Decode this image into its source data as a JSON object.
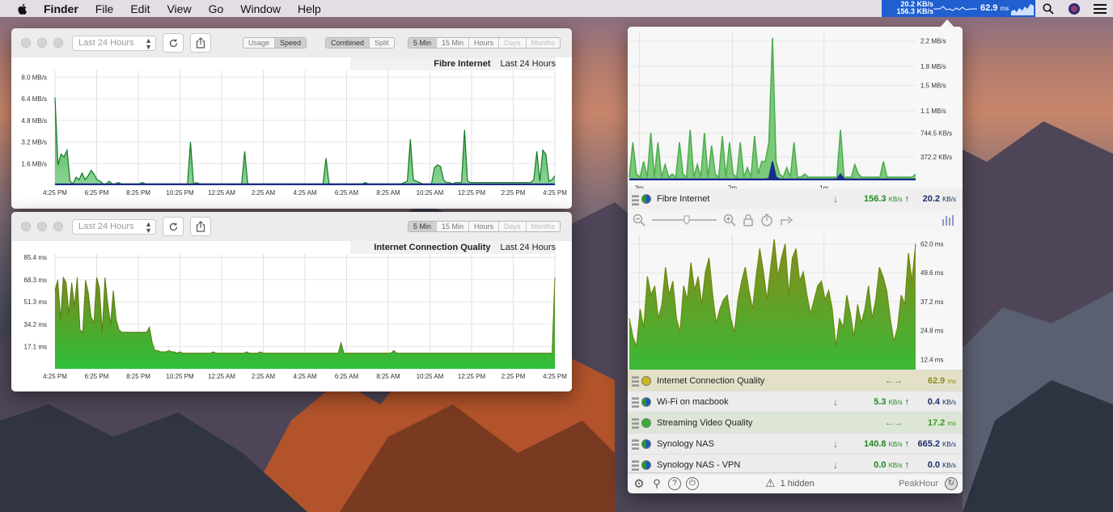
{
  "menubar": {
    "app_name": "Finder",
    "items": [
      "File",
      "Edit",
      "View",
      "Go",
      "Window",
      "Help"
    ],
    "peakhour_down": "20.2 KB/s",
    "peakhour_up": "156.3 KB/s",
    "peakhour_ms": "62.9",
    "peakhour_ms_unit": "ms"
  },
  "window1": {
    "range_popup": "Last 24 Hours",
    "mode_seg": [
      "Usage",
      "Speed"
    ],
    "view_seg": [
      "Combined",
      "Split"
    ],
    "interval_seg": [
      "5 Min",
      "15 Min",
      "Hours",
      "Days",
      "Months"
    ],
    "chart_title": "Fibre Internet",
    "chart_range": "Last 24 Hours"
  },
  "window2": {
    "range_popup": "Last 24 Hours",
    "interval_seg": [
      "5 Min",
      "15 Min",
      "Hours",
      "Days",
      "Months"
    ],
    "chart_title": "Internet Connection Quality",
    "chart_range": "Last 24 Hours"
  },
  "colors": {
    "green": "#2ea52e",
    "navy": "#1a2d8a",
    "olive": "#8b8b1e"
  },
  "chart_data": [
    {
      "type": "area",
      "title": "Fibre Internet",
      "x_ticks": [
        "4:25 PM",
        "6:25 PM",
        "8:25 PM",
        "10:25 PM",
        "12:25 AM",
        "2:25 AM",
        "4:25 AM",
        "6:25 AM",
        "8:25 AM",
        "10:25 AM",
        "12:25 PM",
        "2:25 PM",
        "4:25 PM"
      ],
      "y_ticks": [
        "8.0 MB/s",
        "6.4 MB/s",
        "4.8 MB/s",
        "3.2 MB/s",
        "1.6 MB/s"
      ],
      "ylim": [
        0,
        8.5
      ],
      "series": [
        {
          "values": [
            6.5,
            1.5,
            2.3,
            2.1,
            2.6,
            0.3,
            0.1,
            0.6,
            0.4,
            0.9,
            0.4,
            0.7,
            1.1,
            0.8,
            0.4,
            0.3,
            0.1,
            0.1,
            0.3,
            0.1,
            0.1,
            0.2,
            0.1,
            0.1,
            0.1,
            0.1,
            0.1,
            0.1,
            0.1,
            0.2,
            0.1,
            0.1,
            0.1,
            0.1,
            0.1,
            0.1,
            0.1,
            0.1,
            0.1,
            0.1,
            0.1,
            0.1,
            0.1,
            0.1,
            0.1,
            3.2,
            0.1,
            0.2,
            0.1,
            0.1,
            0.1,
            0.1,
            0.1,
            0.1,
            0.1,
            0.1,
            0.1,
            0.1,
            0.1,
            0.1,
            0.1,
            0.1,
            0.1,
            2.5,
            0.1,
            0.1,
            0.1,
            0.1,
            0.1,
            0.1,
            0.1,
            0.1,
            0.1,
            0.1,
            0.1,
            0.1,
            0.1,
            0.1,
            0.1,
            0.1,
            0.1,
            0.1,
            0.1,
            0.1,
            0.1,
            0.1,
            0.1,
            0.1,
            0.1,
            0.1,
            2.0,
            0.1,
            0.1,
            0.1,
            0.1,
            0.1,
            0.1,
            0.1,
            0.1,
            0.1,
            0.1,
            0.1,
            0.1,
            0.2,
            0.1,
            0.1,
            0.1,
            0.1,
            0.1,
            0.1,
            0.1,
            0.1,
            0.1,
            0.1,
            0.1,
            0.1,
            0.2,
            0.3,
            3.4,
            0.4,
            0.3,
            0.2,
            0.1,
            0.1,
            0.1,
            0.1,
            1.3,
            1.5,
            1.4,
            0.4,
            0.2,
            0.2,
            0.1,
            0.2,
            0.2,
            0.2,
            4.1,
            0.3,
            0.2,
            0.2,
            0.2,
            0.2,
            0.2,
            0.2,
            0.2,
            0.2,
            0.2,
            0.2,
            0.2,
            0.2,
            0.2,
            0.2,
            0.2,
            0.2,
            0.2,
            0.2,
            0.2,
            0.2,
            0.2,
            0.4,
            2.5,
            0.3,
            2.6,
            2.3,
            0.3,
            0.4,
            0.7
          ]
        },
        {
          "values": [
            0.1,
            0.1,
            0.1,
            0.1,
            0.1,
            0.1,
            0.1,
            0.1,
            0.1,
            0.1,
            0.1,
            0.1,
            0.1,
            0.1,
            0.1,
            0.1,
            0.1,
            0.1,
            0.1,
            0.1,
            0.1,
            0.1,
            0.1,
            0.1,
            0.1,
            0.1,
            0.1,
            0.1,
            0.1,
            0.1,
            0.1,
            0.1,
            0.1,
            0.1,
            0.1,
            0.1,
            0.1,
            0.1,
            0.1,
            0.1,
            0.1,
            0.1,
            0.1,
            0.1,
            0.1,
            0.1,
            0.1,
            0.1,
            0.1,
            0.1,
            0.1,
            0.1,
            0.1,
            0.1,
            0.1,
            0.1,
            0.1,
            0.1,
            0.1,
            0.1,
            0.1,
            0.1,
            0.1,
            0.1,
            0.1,
            0.1,
            0.1,
            0.1,
            0.1,
            0.1,
            0.1,
            0.1,
            0.1,
            0.1,
            0.1,
            0.1,
            0.1,
            0.1,
            0.1,
            0.1,
            0.1,
            0.1,
            0.1,
            0.1,
            0.1,
            0.1,
            0.1,
            0.1,
            0.1,
            0.1,
            0.1,
            0.1,
            0.1,
            0.1,
            0.1,
            0.1,
            0.1,
            0.1,
            0.1,
            0.1,
            0.1,
            0.1,
            0.1,
            0.1,
            0.1,
            0.1,
            0.1,
            0.1,
            0.1,
            0.1,
            0.1,
            0.1,
            0.1,
            0.1,
            0.1,
            0.1,
            0.1,
            0.1,
            0.1,
            0.1,
            0.1,
            0.1,
            0.1,
            0.1,
            0.1,
            0.1,
            0.1,
            0.1,
            0.1,
            0.1,
            0.1,
            0.1,
            0.1,
            0.1,
            0.1,
            0.1,
            0.1,
            0.1,
            0.1,
            0.1,
            0.1,
            0.1,
            0.1,
            0.1,
            0.1,
            0.1,
            0.1,
            0.1,
            0.1,
            0.1,
            0.1,
            0.1,
            0.1,
            0.1,
            0.1,
            0.1,
            0.1,
            0.1,
            0.1,
            0.1,
            0.1,
            0.1,
            0.1,
            0.1,
            0.1,
            0.1,
            0.1,
            0.1,
            0.1,
            0.1,
            0.1,
            0.1,
            0.1
          ]
        }
      ]
    },
    {
      "type": "area",
      "title": "Internet Connection Quality",
      "x_ticks": [
        "4:25 PM",
        "6:25 PM",
        "8:25 PM",
        "10:25 PM",
        "12:25 AM",
        "2:25 AM",
        "4:25 AM",
        "6:25 AM",
        "8:25 AM",
        "10:25 AM",
        "12:25 PM",
        "2:25 PM",
        "4:25 PM"
      ],
      "y_ticks": [
        "85.4 ms",
        "68.3 ms",
        "51.3 ms",
        "34.2 ms",
        "17.1 ms"
      ],
      "ylim": [
        0,
        88
      ],
      "series": [
        {
          "values": [
            60,
            68,
            38,
            70,
            66,
            42,
            66,
            48,
            70,
            30,
            28,
            68,
            58,
            40,
            35,
            70,
            62,
            28,
            70,
            50,
            34,
            60,
            38,
            30,
            28,
            28,
            28,
            28,
            28,
            28,
            28,
            28,
            28,
            28,
            32,
            20,
            14,
            14,
            13,
            13,
            13,
            14,
            13,
            13,
            12,
            13,
            12,
            12,
            12,
            12,
            12,
            12,
            12,
            12,
            12,
            12,
            12,
            13,
            12,
            12,
            12,
            12,
            12,
            12,
            12,
            12,
            12,
            12,
            12,
            13,
            12,
            12,
            12,
            12,
            13,
            12,
            12,
            12,
            12,
            12,
            12,
            12,
            12,
            12,
            12,
            12,
            12,
            12,
            12,
            12,
            12,
            12,
            12,
            12,
            12,
            12,
            12,
            12,
            12,
            12,
            12,
            12,
            12,
            20,
            12,
            12,
            12,
            12,
            12,
            12,
            12,
            12,
            12,
            12,
            12,
            12,
            12,
            12,
            12,
            12,
            12,
            12,
            14,
            12,
            12,
            12,
            12,
            12,
            12,
            12,
            12,
            12,
            12,
            12,
            12,
            12,
            12,
            12,
            12,
            12,
            12,
            12,
            12,
            12,
            12,
            12,
            12,
            12,
            12,
            12,
            12,
            12,
            12,
            12,
            12,
            12,
            12,
            12,
            12,
            12,
            12,
            12,
            12,
            12,
            12,
            12,
            12,
            12,
            12,
            12,
            12,
            12,
            12,
            12,
            12,
            12,
            12,
            12,
            12,
            12,
            70
          ]
        }
      ]
    },
    {
      "type": "area",
      "title": "",
      "x_ticks": [
        "3m",
        "2m",
        "1m"
      ],
      "y_ticks": [
        "2.2 MB/s",
        "1.8 MB/s",
        "1.5 MB/s",
        "1.1 MB/s",
        "744.5 KB/s",
        "372.2 KB/s"
      ],
      "ylim": [
        0,
        2.35
      ],
      "series": [
        {
          "values": [
            0.05,
            0.6,
            0.1,
            0.05,
            0.3,
            0.05,
            0.75,
            0.05,
            0.6,
            0.05,
            0.25,
            0.05,
            0.1,
            0.05,
            0.6,
            0.1,
            0.05,
            0.8,
            0.05,
            0.25,
            0.05,
            0.75,
            0.05,
            0.55,
            0.1,
            0.05,
            0.7,
            0.05,
            0.6,
            0.1,
            0.05,
            0.6,
            0.05,
            0.2,
            0.05,
            0.7,
            0.1,
            0.3,
            0.3,
            0.6,
            2.25,
            0.3,
            0.1,
            0.05,
            0.2,
            0.05,
            0.6,
            0.05,
            0.05,
            0.1,
            0.05,
            0.05,
            0.05,
            0.05,
            0.05,
            0.05,
            0.05,
            0.05,
            0.05,
            0.8,
            0.05,
            0.05,
            0.05,
            0.25,
            0.1,
            0.05,
            0.05,
            0.05,
            0.05,
            0.05,
            0.05,
            0.3,
            0.05,
            0.05,
            0.05,
            0.05,
            0.05,
            0.05,
            0.05,
            0.05,
            0.1
          ]
        },
        {
          "values": [
            0.02,
            0.02,
            0.02,
            0.02,
            0.02,
            0.02,
            0.02,
            0.02,
            0.02,
            0.02,
            0.02,
            0.02,
            0.02,
            0.02,
            0.02,
            0.02,
            0.02,
            0.02,
            0.02,
            0.02,
            0.02,
            0.02,
            0.02,
            0.02,
            0.02,
            0.02,
            0.02,
            0.02,
            0.02,
            0.02,
            0.02,
            0.02,
            0.02,
            0.02,
            0.02,
            0.02,
            0.02,
            0.02,
            0.02,
            0.03,
            0.3,
            0.05,
            0.02,
            0.02,
            0.02,
            0.02,
            0.02,
            0.02,
            0.02,
            0.02,
            0.02,
            0.02,
            0.02,
            0.02,
            0.02,
            0.02,
            0.02,
            0.02,
            0.02,
            0.1,
            0.02,
            0.02,
            0.02,
            0.02,
            0.02,
            0.02,
            0.02,
            0.02,
            0.02,
            0.02,
            0.02,
            0.02,
            0.02,
            0.02,
            0.02,
            0.02,
            0.02,
            0.02,
            0.02,
            0.02,
            0.02
          ]
        }
      ]
    },
    {
      "type": "area",
      "title": "",
      "x_ticks": [
        "3m",
        "2m",
        "1m"
      ],
      "y_ticks": [
        "62.0 ms",
        "49.6 ms",
        "37.2 ms",
        "24.8 ms",
        "12.4 ms"
      ],
      "ylim": [
        0,
        66
      ],
      "series": [
        {
          "values": [
            30,
            22,
            18,
            34,
            26,
            48,
            40,
            44,
            30,
            36,
            52,
            40,
            46,
            30,
            24,
            44,
            38,
            54,
            42,
            48,
            36,
            50,
            56,
            40,
            28,
            34,
            38,
            40,
            30,
            24,
            38,
            46,
            52,
            42,
            34,
            48,
            60,
            50,
            38,
            52,
            64,
            48,
            56,
            62,
            40,
            56,
            60,
            46,
            50,
            40,
            32,
            38,
            44,
            46,
            38,
            42,
            34,
            18,
            30,
            26,
            40,
            32,
            22,
            36,
            28,
            34,
            44,
            30,
            38,
            52,
            48,
            42,
            30,
            20,
            26,
            40,
            36,
            58,
            46,
            62
          ]
        }
      ]
    }
  ],
  "panel": {
    "rows": [
      {
        "name": "Fibre Internet",
        "down": "156.3",
        "up": "20.2",
        "unit": "KB/s"
      },
      {
        "name": "Internet Connection Quality",
        "value": "62.9",
        "unit": "ms"
      },
      {
        "name": "Wi-Fi on macbook",
        "down": "5.3",
        "up": "0.4",
        "unit": "KB/s"
      },
      {
        "name": "Streaming Video Quality",
        "value": "17.2",
        "unit": "ms"
      },
      {
        "name": "Synology NAS",
        "down": "140.8",
        "up": "665.2",
        "unit": "KB/s"
      },
      {
        "name": "Synology NAS - VPN",
        "down": "0.0",
        "up": "0.0",
        "unit": "KB/s"
      }
    ],
    "hidden_label": "1 hidden",
    "brand": "PeakHour"
  }
}
